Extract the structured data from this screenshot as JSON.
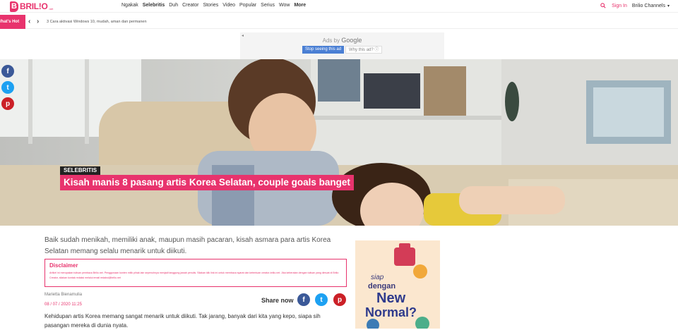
{
  "header": {
    "logo_text": "BRIL!O",
    "logo_sub": ".net",
    "nav": [
      "Ngakak",
      "Selebritis",
      "Duh",
      "Creator",
      "Stories",
      "Video",
      "Popular",
      "Serius",
      "Wow",
      "More"
    ],
    "active_nav": "Selebritis",
    "signin": "Sign In",
    "channels": "Brilio Channels"
  },
  "hotbar": {
    "label": "What's Hot",
    "headline": "3 Cara aktivasi Windows 10, mudah, aman dan permanen"
  },
  "ad": {
    "ads_by": "Ads by",
    "google": "Google",
    "stop_button": "Stop seeing this ad",
    "why_button": "Why this ad? ⓘ"
  },
  "article": {
    "category": "SELEBRITIS",
    "title": "Kisah manis 8 pasang artis Korea Selatan, couple goals banget",
    "lead": "Baik sudah menikah, memiliki anak, maupun masih pacaran, kisah asmara para artis Korea Selatan memang selalu menarik untuk diikuti.",
    "disclaimer_title": "Disclaimer",
    "disclaimer_body": "Artikel ini merupakan tulisan pembaca Brilio.net. Penggunaan konten milik pihak lain sepenuhnya menjadi tanggung jawab penulis. Silakan klik link ini untuk membaca syarat dan ketentuan creator-brilio.net. Jika keberatan dengan tulisan yang dimuat di Brilio Creator, silakan kontak redaksi melalui email redaksi@brilio.net",
    "author": "Marietta Bienamulia",
    "date": "08 / 07 / 2020 11:25",
    "share_label": "Share now",
    "body": "Kehidupan artis Korea memang sangat menarik untuk diikuti. Tak jarang, banyak dari kita yang kepo, siapa sih pasangan mereka di dunia nyata."
  },
  "side_ad": {
    "line1": "siap",
    "line2": "dengan",
    "line3": "New",
    "line4": "Normal?"
  },
  "colors": {
    "brand": "#e8336d",
    "facebook": "#3b5998",
    "twitter": "#1da1f2",
    "pinterest": "#cb2027"
  }
}
